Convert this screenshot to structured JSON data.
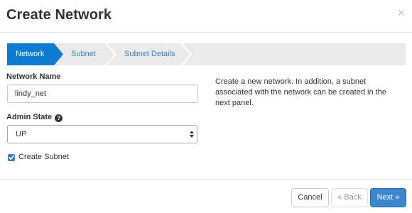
{
  "modal": {
    "title": "Create Network",
    "close_glyph": "×"
  },
  "wizard": {
    "steps": [
      {
        "label": "Network",
        "active": true
      },
      {
        "label": "Subnet",
        "active": false
      },
      {
        "label": "Subnet Details",
        "active": false
      }
    ],
    "active_color": "#0d7bd1",
    "inactive_color": "#eaeaea",
    "link_color": "#3a86c8"
  },
  "form": {
    "network_name": {
      "label": "Network Name",
      "value": "lindy_net"
    },
    "admin_state": {
      "label": "Admin State",
      "help_glyph": "?",
      "help_icon": "question-circle-icon",
      "selected": "UP"
    },
    "create_subnet": {
      "label": "Create Subnet",
      "checked": true
    }
  },
  "description": "Create a new network. In addition, a subnet associated with the network can be created in the next panel.",
  "footer": {
    "cancel_label": "Cancel",
    "back_label": "« Back",
    "next_label": "Next »"
  },
  "colors": {
    "primary": "#3a87d0",
    "checkbox": "#3b7fd0"
  }
}
